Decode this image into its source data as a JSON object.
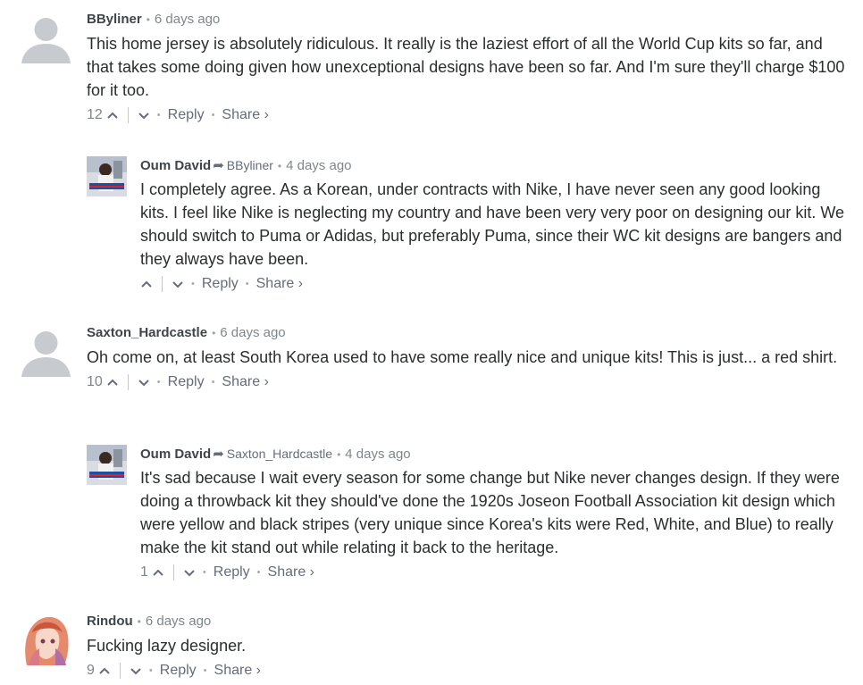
{
  "comments": [
    {
      "author": "BByliner",
      "time": "6 days ago",
      "text": "This home jersey is absolutely ridiculous. It really is the laziest effort of all the World Cup kits so far, and that takes some doing given how unexceptional designs have been so far. And I'm sure they'll charge $100 for it too.",
      "votes": "12",
      "avatar": "default-avatar"
    },
    {
      "author": "Oum David",
      "reply_to": "BByliner",
      "time": "4 days ago",
      "text": "I completely agree. As a Korean, under contracts with Nike, I have never seen any good looking kits. I feel like Nike is neglecting my country and have been very very poor on designing our kit. We should switch to Puma or Adidas, but preferably Puma, since their WC kit designs are bangers and they always have been.",
      "votes": "",
      "avatar": "photo-avatar"
    },
    {
      "author": "Saxton_Hardcastle",
      "time": "6 days ago",
      "text": "Oh come on, at least South Korea used to have some really nice and unique kits! This is just... a red shirt.",
      "votes": "10",
      "avatar": "default-avatar"
    },
    {
      "author": "Oum David",
      "reply_to": "Saxton_Hardcastle",
      "time": "4 days ago",
      "text": "It's sad because I wait every season for some change but Nike never changes design. If they were doing a throwback kit they should've done the 1920s Joseon Football Association kit design which were yellow and black stripes (very unique since Korea's kits were Red, White, and Blue) to really make the kit stand out while relating it back to the heritage.",
      "votes": "1",
      "avatar": "photo-avatar"
    },
    {
      "author": "Rindou",
      "time": "6 days ago",
      "text": "Fucking lazy designer.",
      "votes": "9",
      "avatar": "anime-avatar"
    }
  ],
  "actions": {
    "reply": "Reply",
    "share": "Share ›"
  },
  "separators": {
    "dot": "•",
    "reply_arrow": "➦"
  },
  "colors": {
    "text": "#2a2e2e",
    "meta": "#656c7a",
    "default_avatar": "#c7cbcf"
  }
}
